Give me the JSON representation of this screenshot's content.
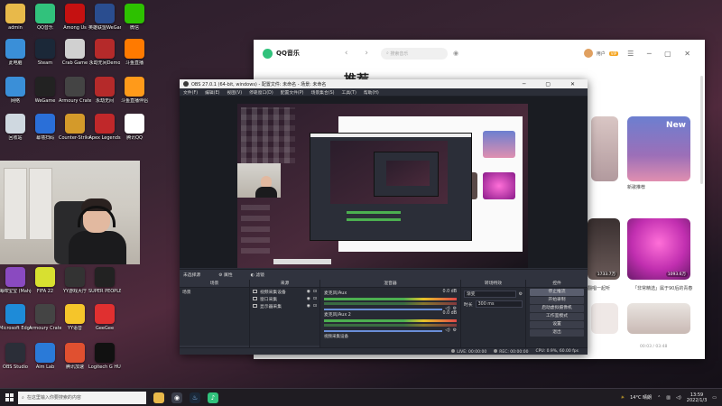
{
  "desktop": {
    "icons": [
      {
        "label": "admin",
        "icon": "folder-icon",
        "color": "#e8b94a"
      },
      {
        "label": "QQ音乐",
        "icon": "qq-music-icon",
        "color": "#31c27c"
      },
      {
        "label": "Among Us",
        "icon": "among-us-icon",
        "color": "#c51111"
      },
      {
        "label": "英雄联盟WeGame版",
        "icon": "lol-icon",
        "color": "#2a4d8f"
      },
      {
        "label": "微信",
        "icon": "wechat-icon",
        "color": "#2dc100"
      },
      {
        "label": "此电脑",
        "icon": "computer-icon",
        "color": "#3a8fd8"
      },
      {
        "label": "Steam",
        "icon": "steam-icon",
        "color": "#1b2838"
      },
      {
        "label": "Crab Game",
        "icon": "crab-game-icon",
        "color": "#d0d0d0"
      },
      {
        "label": "永劫无间Demo",
        "icon": "naraka-icon",
        "color": "#b52a2a"
      },
      {
        "label": "斗鱼直播",
        "icon": "douyu-icon",
        "color": "#ff7a00"
      },
      {
        "label": "网络",
        "icon": "network-icon",
        "color": "#3a8fd8"
      },
      {
        "label": "WeGame",
        "icon": "wegame-icon",
        "color": "#222"
      },
      {
        "label": "Armoury Crate v3.0.11.0",
        "icon": "armoury-icon",
        "color": "#444"
      },
      {
        "label": "永劫无间",
        "icon": "naraka-icon",
        "color": "#b52a2a"
      },
      {
        "label": "斗鱼直播伴侣",
        "icon": "douyu-companion-icon",
        "color": "#ff9a1a"
      },
      {
        "label": "回收站",
        "icon": "recycle-bin-icon",
        "color": "#cfd8e0"
      },
      {
        "label": "幕墙扫码",
        "icon": "qr-icon",
        "color": "#2a6fd8"
      },
      {
        "label": "Counter-Strike Global Of...",
        "icon": "csgo-icon",
        "color": "#d49a2a"
      },
      {
        "label": "Apex Legends",
        "icon": "apex-icon",
        "color": "#c0282a"
      },
      {
        "label": "腾讯QQ",
        "icon": "qq-icon",
        "color": "#fff"
      },
      {
        "label": "海绵宝宝 (Mahjong...",
        "icon": "game-icon",
        "color": "#8a4ac0"
      },
      {
        "label": "FIFA 22",
        "icon": "fifa-icon",
        "color": "#d8e030"
      },
      {
        "label": "YY游戏大厅",
        "icon": "yy-game-icon",
        "color": "#333"
      },
      {
        "label": "SUPER PEOPLE CBT",
        "icon": "super-people-icon",
        "color": "#222"
      },
      {
        "label": "Microsoft Edge",
        "icon": "edge-icon",
        "color": "#1e8bd8"
      },
      {
        "label": "Armoury Crate - ...",
        "icon": "armoury-icon",
        "color": "#444"
      },
      {
        "label": "YY语音",
        "icon": "yy-icon",
        "color": "#f5c52a"
      },
      {
        "label": "GeeGee",
        "icon": "geegee-icon",
        "color": "#e03030"
      },
      {
        "label": "OBS Studio",
        "icon": "obs-icon",
        "color": "#2b2e38"
      },
      {
        "label": "Aim Lab",
        "icon": "aim-lab-icon",
        "color": "#2a7ad8"
      },
      {
        "label": "腾讯加速",
        "icon": "accelerator-icon",
        "color": "#e05030"
      },
      {
        "label": "Logitech G HUB",
        "icon": "logitech-icon",
        "color": "#111"
      }
    ]
  },
  "qq_music": {
    "logo": "QQ音乐",
    "search_placeholder": "搜索音乐",
    "heading": "推荐",
    "user": "用户",
    "vip": "VIP",
    "cards": [
      {
        "label": "New",
        "sub": "新歌推荐"
      },
      {
        "label": "1733.7万",
        "sub": "翻唱一起听"
      },
      {
        "label": "1093.6万",
        "sub": "「非常精选」属于90后的青春"
      }
    ],
    "pager": "00:03 / 03:48"
  },
  "obs": {
    "title": "OBS 27.0.1 (64-bit, windows) - 配置文件: 未命名 - 场景: 未命名",
    "menu": [
      "文件(F)",
      "编辑(E)",
      "视图(V)",
      "停靠窗口(D)",
      "配置文件(P)",
      "场景集合(S)",
      "工具(T)",
      "帮助(H)"
    ],
    "scene_bar": [
      "未选择源",
      "属性",
      "滤镜"
    ],
    "docks": {
      "scenes": "场景",
      "sources": "来源",
      "mixer": "混音器",
      "transitions": "转场特效",
      "controls": "控件"
    },
    "scene_item": "场景",
    "sources": [
      "视频采集设备",
      "窗口采集",
      "显示器采集"
    ],
    "mixer_items": [
      {
        "name": "麦克风/Aux",
        "db": "0.0 dB"
      },
      {
        "name": "麦克风/Aux 2",
        "db": "0.0 dB"
      }
    ],
    "mixer_footer": "视频采集设备",
    "transition": {
      "type": "渐变",
      "duration_label": "时长",
      "duration": "300 ms"
    },
    "controls": [
      "停止推流",
      "开始录制",
      "启动虚拟摄像机",
      "工作室模式",
      "设置",
      "退出"
    ],
    "status": {
      "live": "LIVE: 00:00:00",
      "rec": "REC: 00:00:00",
      "cpu": "CPU: 0.9%, 60.00 fps"
    }
  },
  "taskbar": {
    "search_placeholder": "在这里输入你要搜索的内容",
    "weather": "14°C 晴朗",
    "time": "13:59",
    "date": "2022/1/3"
  }
}
